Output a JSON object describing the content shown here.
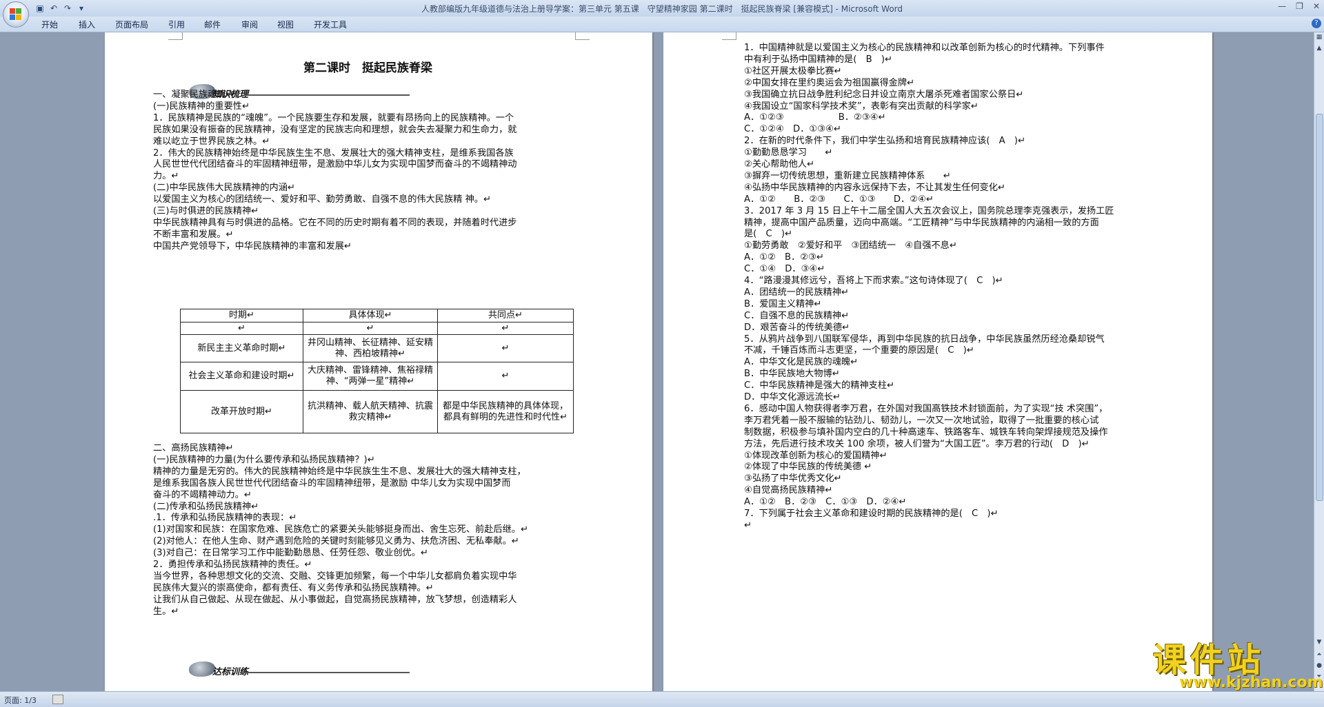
{
  "window": {
    "title": "人教部编版九年级道德与法治上册导学案：第三单元 第五课　守望精神家园 第二课时　挺起民族脊梁 [兼容模式] - Microsoft Word"
  },
  "ribbon": {
    "tabs": [
      "开始",
      "插入",
      "页面布局",
      "引用",
      "邮件",
      "审阅",
      "视图",
      "开发工具"
    ]
  },
  "statusbar": {
    "page": "页面: 1/3"
  },
  "left_page": {
    "title": "第二课时　挺起民族脊梁",
    "banner1": "知识梳理",
    "banner2": "达标训练",
    "lines": [
      "一、凝聚民族魂魄↵",
      "(一)民族精神的重要性↵",
      "1．民族精神是民族的“魂魄”。一个民族要生存和发展，就要有昂扬向上的民族精神。一个",
      "民族如果没有振奋的民族精神，没有坚定的民族志向和理想，就会失去凝聚力和生命力，就",
      "难以屹立于世界民族之林。↵",
      "2．伟大的民族精神始终是中华民族生生不息、发展壮大的强大精神支柱，是维系我国各族",
      "人民世世代代团结奋斗的牢固精神纽带，是激励中华儿女为实现中国梦而奋斗的不竭精神动",
      "力。↵",
      "(二)中华民族伟大民族精神的内涵↵",
      "以爱国主义为核心的团结统一、爱好和平、勤劳勇敢、自强不息的伟大民族精 神。↵",
      "(三)与时俱进的民族精神↵",
      "中华民族精神具有与时俱进的品格。它在不同的历史时期有着不同的表现，并随着时代进步",
      "不断丰富和发展。↵",
      "中国共产党领导下，中华民族精神的丰富和发展↵"
    ],
    "table": {
      "headers": [
        "时期↵",
        "具体体现↵",
        "共同点↵"
      ],
      "rows": [
        [
          "↵",
          "↵",
          "↵"
        ],
        [
          "新民主主义革命时期↵",
          "井冈山精神、长征精神、延安精神、西柏坡精神↵",
          "↵"
        ],
        [
          "社会主义革命和建设时期↵",
          "大庆精神、雷锋精神、焦裕禄精神、“两弹一星”精神↵",
          "↵"
        ],
        [
          "改革开放时期↵",
          "抗洪精神、载人航天精神、抗震救灾精神↵",
          "都是中华民族精神的具体体现，都具有鲜明的先进性和时代性↵"
        ]
      ]
    },
    "lines2": [
      "二、高扬民族精神↵",
      "(一)民族精神的力量(为什么要传承和弘扬民族精神？)↵",
      "精神的力量是无穷的。伟大的民族精神始终是中华民族生生不息、发展壮大的强大精神支柱，",
      "是维系我国各族人民世世代代团结奋斗的牢固精神纽带，是激励 中华儿女为实现中国梦而",
      "奋斗的不竭精神动力。↵",
      "(二)传承和弘扬民族精神↵",
      ".1．传承和弘扬民族精神的表现：↵",
      "(1)对国家和民族：在国家危难、民族危亡的紧要关头能够挺身而出、舍生忘死、前赴后继。↵",
      "(2)对他人：在他人生命、财产遇到危险的关键时刻能够见义勇为、扶危济困、无私奉献。↵",
      "(3)对自己：在日常学习工作中能勤勤恳恳、任劳任怨、敬业创优。↵",
      "2．勇担传承和弘扬民族精神的责任。↵",
      "当今世界，各种思想文化的交流、交融、交锋更加频繁，每一个中华儿女都肩负着实现中华",
      "民族伟大复兴的崇高使命，都有责任、有义务传承和弘扬民族精神。↵",
      "让我们从自己做起、从现在做起、从小事做起，自觉高扬民族精神，放飞梦想，创造精彩人",
      "生。↵"
    ]
  },
  "right_page": {
    "lines": [
      "1．中国精神就是以爱国主义为核心的民族精神和以改革创新为核心的时代精神。下列事件",
      "中有利于弘扬中国精神的是(　B　)↵",
      "①社区开展太极拳比赛↵",
      "②中国女排在里约奥运会为祖国赢得金牌↵",
      "③我国确立抗日战争胜利纪念日并设立南京大屠杀死难者国家公祭日↵",
      "④我国设立“国家科学技术奖”，表彰有突出贡献的科学家↵",
      "A．①②③　　　　　　B．②③④↵",
      "C．①②④　D．①③④↵",
      "2．在新的时代条件下，我们中学生弘扬和培育民族精神应该(　A　)↵",
      "①勤勤恳恳学习　　↵",
      "②关心帮助他人↵",
      "③摒弃一切传统思想，重新建立民族精神体系　　↵",
      "④弘扬中华民族精神的内容永远保持下去，不让其发生任何变化↵",
      "A．①②　　B．②③　　C．①③　　D．②④↵",
      "3．2017 年 3 月 15 日上午十二届全国人大五次会议上，国务院总理李克强表示，发扬工匠",
      "精神，提高中国产品质量，迈向中高端。“工匠精神”与中华民族精神的内涵相一致的方面",
      "是(　C　)↵",
      "①勤劳勇敢　②爱好和平　③团结统一　④自强不息↵",
      "A．①②　B．②③↵",
      "C．①④　D．③④↵",
      "4．“路漫漫其修远兮，吾将上下而求索。”这句诗体现了(　C　)↵",
      "A．团结统一的民族精神↵",
      "B．爱国主义精神↵",
      "C．自强不息的民族精神↵",
      "D．艰苦奋斗的传统美德↵",
      "5．从鸦片战争到八国联军侵华，再到中华民族的抗日战争，中华民族虽然历经沧桑却锐气",
      "不减，千锤百炼而斗志更坚，一个重要的原因是(　C　)↵",
      "A．中华文化是民族的魂魄↵",
      "B．中华民族地大物博↵",
      "C．中华民族精神是强大的精神支柱↵",
      "D．中华文化源远流长↵",
      "6．感动中国人物获得者李万君，在外国对我国高铁技术封锁面前，为了实现“技 术突围”，",
      "李万君凭着一股不服输的钻劲儿、韧劲儿，一次又一次地试验，取得了一批重要的核心试",
      "制数据，积极参与填补国内空白的几十种高速车、铁路客车、城铁车转向架焊接规范及操作",
      "方法，先后进行技术攻关 100 余项，被人们誉为“大国工匠”。李万君的行动(　D　)↵",
      "①体现改革创新为核心的爱国精神↵",
      "②体现了中华民族的传统美德 ↵",
      "③弘扬了中华优秀文化↵",
      "④自觉高扬民族精神↵",
      "A．①②　B．②③　C．①③　D．②④↵",
      "7．下列属于社会主义革命和建设时期的民族精神的是(　C　)↵",
      "↵"
    ]
  },
  "watermark": {
    "text": "课件站",
    "url": "www.kjzhan.com"
  },
  "colors": {
    "ribbon": "#c9d9ee",
    "workspace": "#8e9db2",
    "watermark": "#f2d21e"
  }
}
